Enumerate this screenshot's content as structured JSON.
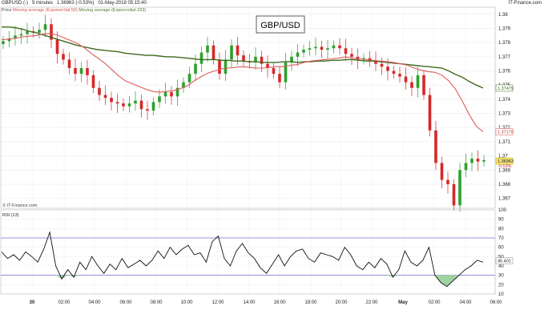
{
  "header": {
    "symbol": "GBPUSD (-)",
    "interval": "5 minutes",
    "price": "1.36963 (-0.53%)",
    "datetime": "01-May-2018 05:15:40",
    "brand": "IT-Finance.com"
  },
  "legend": {
    "prefix": "Price",
    "ma50": "Moving average (Exponential 50)",
    "ma233": "Moving average (Exponential 233)"
  },
  "watermark": "© IT-Finance.com",
  "colors": {
    "up": "#2ca02c",
    "down": "#d62728",
    "ma50": "#e05a5a",
    "ma233": "#3d6b1f",
    "rsi": "#111111",
    "rsi_bands": "#7777cc",
    "rsi_fill": "#9fd29f",
    "price_tag": "#f5e37a"
  },
  "chart_data": [
    {
      "type": "candlestick",
      "title": "GBP/USD",
      "ylim": [
        1.3663,
        1.3805
      ],
      "y_ticks": [
        "1.38",
        "1.379",
        "1.378",
        "1.377",
        "1.376",
        "1.375",
        "1.374",
        "1.373",
        "1.372",
        "1.371",
        "1.37",
        "1.369",
        "1.368",
        "1.367"
      ],
      "x_ticks": [
        "30",
        "02:00",
        "04:00",
        "06:00",
        "08:00",
        "10:00",
        "12:00",
        "14:00",
        "16:00",
        "18:00",
        "20:00",
        "22:00",
        "May",
        "02:00",
        "04:00",
        "06:00"
      ],
      "grid": true,
      "last_price": "1.36963",
      "last_change": "-0.53%",
      "ma233_last": "1.37479",
      "ma50_last": "1.37170",
      "series": [
        {
          "name": "Moving average (Exponential 50)",
          "values": [
            1.3782,
            1.37825,
            1.3783,
            1.3784,
            1.37845,
            1.3785,
            1.3786,
            1.37865,
            1.37855,
            1.37835,
            1.37815,
            1.37795,
            1.37765,
            1.37725,
            1.3769,
            1.37655,
            1.3761,
            1.37565,
            1.3753,
            1.3751,
            1.3749,
            1.3747,
            1.37455,
            1.3745,
            1.37455,
            1.3746,
            1.37475,
            1.37495,
            1.3753,
            1.3756,
            1.37585,
            1.376,
            1.37615,
            1.3762,
            1.37625,
            1.3763,
            1.37625,
            1.3762,
            1.3762,
            1.37625,
            1.3763,
            1.3763,
            1.3764,
            1.37645,
            1.3766,
            1.3767,
            1.37675,
            1.3768,
            1.37685,
            1.3769,
            1.377,
            1.3769,
            1.37685,
            1.3768,
            1.37675,
            1.3767,
            1.37665,
            1.3766,
            1.3765,
            1.3764,
            1.3762,
            1.37605,
            1.37595,
            1.3759,
            1.3757,
            1.3753,
            1.3747,
            1.37385,
            1.3729,
            1.3721,
            1.3717
          ]
        },
        {
          "name": "Moving average (Exponential 233)",
          "values": [
            1.3791,
            1.3791,
            1.37905,
            1.37895,
            1.3788,
            1.3787,
            1.37855,
            1.3784,
            1.37825,
            1.3781,
            1.37795,
            1.3778,
            1.3777,
            1.3776,
            1.3775,
            1.37745,
            1.3774,
            1.37735,
            1.37725,
            1.3772,
            1.37715,
            1.3771,
            1.3771,
            1.37705,
            1.377,
            1.377,
            1.37695,
            1.3769,
            1.37685,
            1.3768,
            1.3768,
            1.3768,
            1.37675,
            1.37675,
            1.3767,
            1.3767,
            1.37665,
            1.37665,
            1.3766,
            1.3766,
            1.3766,
            1.37665,
            1.37665,
            1.3766,
            1.37665,
            1.37665,
            1.3767,
            1.3767,
            1.37675,
            1.37675,
            1.3768,
            1.3768,
            1.37675,
            1.3767,
            1.3767,
            1.37665,
            1.3766,
            1.37655,
            1.3765,
            1.37645,
            1.3764,
            1.37635,
            1.3763,
            1.37625,
            1.3762,
            1.376,
            1.37575,
            1.37555,
            1.37525,
            1.375,
            1.37479
          ]
        }
      ],
      "candles": [
        1.3781,
        1.3783,
        1.3785,
        1.3786,
        1.3788,
        1.3787,
        1.3789,
        1.3793,
        1.3782,
        1.3772,
        1.3768,
        1.3762,
        1.3758,
        1.3762,
        1.3757,
        1.3748,
        1.3743,
        1.3741,
        1.3738,
        1.3737,
        1.3735,
        1.3737,
        1.3739,
        1.3733,
        1.3732,
        1.3738,
        1.3742,
        1.3745,
        1.3742,
        1.3748,
        1.3752,
        1.3758,
        1.3765,
        1.3773,
        1.3778,
        1.3768,
        1.3758,
        1.3768,
        1.3778,
        1.3771,
        1.3767,
        1.3766,
        1.377,
        1.3765,
        1.3762,
        1.3758,
        1.3752,
        1.3766,
        1.377,
        1.3773,
        1.3775,
        1.3776,
        1.3777,
        1.3775,
        1.3776,
        1.3778,
        1.3776,
        1.3772,
        1.377,
        1.3768,
        1.3769,
        1.3767,
        1.3765,
        1.3763,
        1.376,
        1.3758,
        1.3756,
        1.3752,
        1.3748,
        1.3757,
        1.3743,
        1.3718,
        1.3695,
        1.3683,
        1.368,
        1.3665,
        1.369,
        1.3695,
        1.3698,
        1.3696,
        1.3697
      ]
    },
    {
      "type": "line",
      "title": "RSI (13)",
      "ylim": [
        10,
        100
      ],
      "y_ticks": [
        "100",
        "90",
        "80",
        "70",
        "60",
        "50",
        "40",
        "30",
        "20",
        "10"
      ],
      "bands": [
        70,
        30
      ],
      "last_value": "45.401",
      "values": [
        55,
        48,
        52,
        46,
        55,
        50,
        44,
        58,
        76,
        40,
        26,
        36,
        28,
        44,
        36,
        50,
        40,
        32,
        42,
        36,
        48,
        38,
        42,
        46,
        40,
        46,
        56,
        48,
        60,
        52,
        58,
        62,
        52,
        54,
        44,
        66,
        72,
        48,
        40,
        56,
        64,
        54,
        48,
        38,
        32,
        42,
        52,
        40,
        50,
        56,
        58,
        48,
        44,
        54,
        52,
        50,
        46,
        60,
        52,
        40,
        36,
        44,
        38,
        48,
        42,
        28,
        36,
        56,
        44,
        40,
        46,
        60,
        30,
        22,
        18,
        24,
        30,
        36,
        40,
        46,
        44
      ]
    }
  ]
}
